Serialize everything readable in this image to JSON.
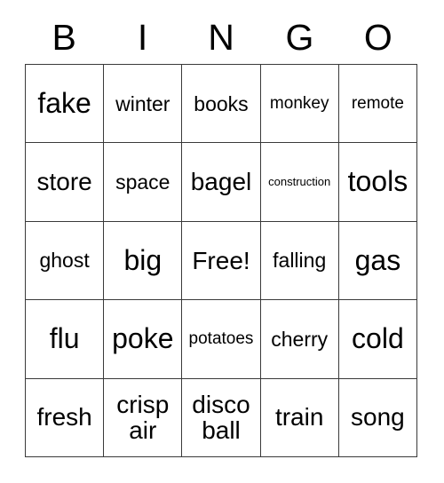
{
  "card": {
    "title": "BINGO",
    "header_letters": [
      "B",
      "I",
      "N",
      "G",
      "O"
    ],
    "grid": {
      "columns": 5,
      "rows": 5,
      "free_space": "Free!",
      "cells": [
        [
          {
            "label": "fake",
            "size": "xl"
          },
          {
            "label": "winter",
            "size": "md"
          },
          {
            "label": "books",
            "size": "md"
          },
          {
            "label": "monkey",
            "size": "sm"
          },
          {
            "label": "remote",
            "size": "sm"
          }
        ],
        [
          {
            "label": "store",
            "size": "lg"
          },
          {
            "label": "space",
            "size": "md"
          },
          {
            "label": "bagel",
            "size": "lg"
          },
          {
            "label": "construction",
            "size": "xs"
          },
          {
            "label": "tools",
            "size": "xl"
          }
        ],
        [
          {
            "label": "ghost",
            "size": "md"
          },
          {
            "label": "big",
            "size": "xl"
          },
          {
            "label": "Free!",
            "size": "lg"
          },
          {
            "label": "falling",
            "size": "md"
          },
          {
            "label": "gas",
            "size": "xl"
          }
        ],
        [
          {
            "label": "flu",
            "size": "xl"
          },
          {
            "label": "poke",
            "size": "xl"
          },
          {
            "label": "potatoes",
            "size": "sm"
          },
          {
            "label": "cherry",
            "size": "md"
          },
          {
            "label": "cold",
            "size": "xl"
          }
        ],
        [
          {
            "label": "fresh",
            "size": "lg"
          },
          {
            "label": "crisp\nair",
            "size": "lg"
          },
          {
            "label": "disco\nball",
            "size": "lg"
          },
          {
            "label": "train",
            "size": "lg"
          },
          {
            "label": "song",
            "size": "lg"
          }
        ]
      ]
    },
    "colors": {
      "background": "#ffffff",
      "text": "#000000",
      "grid_line": "#3a3a3a"
    }
  }
}
